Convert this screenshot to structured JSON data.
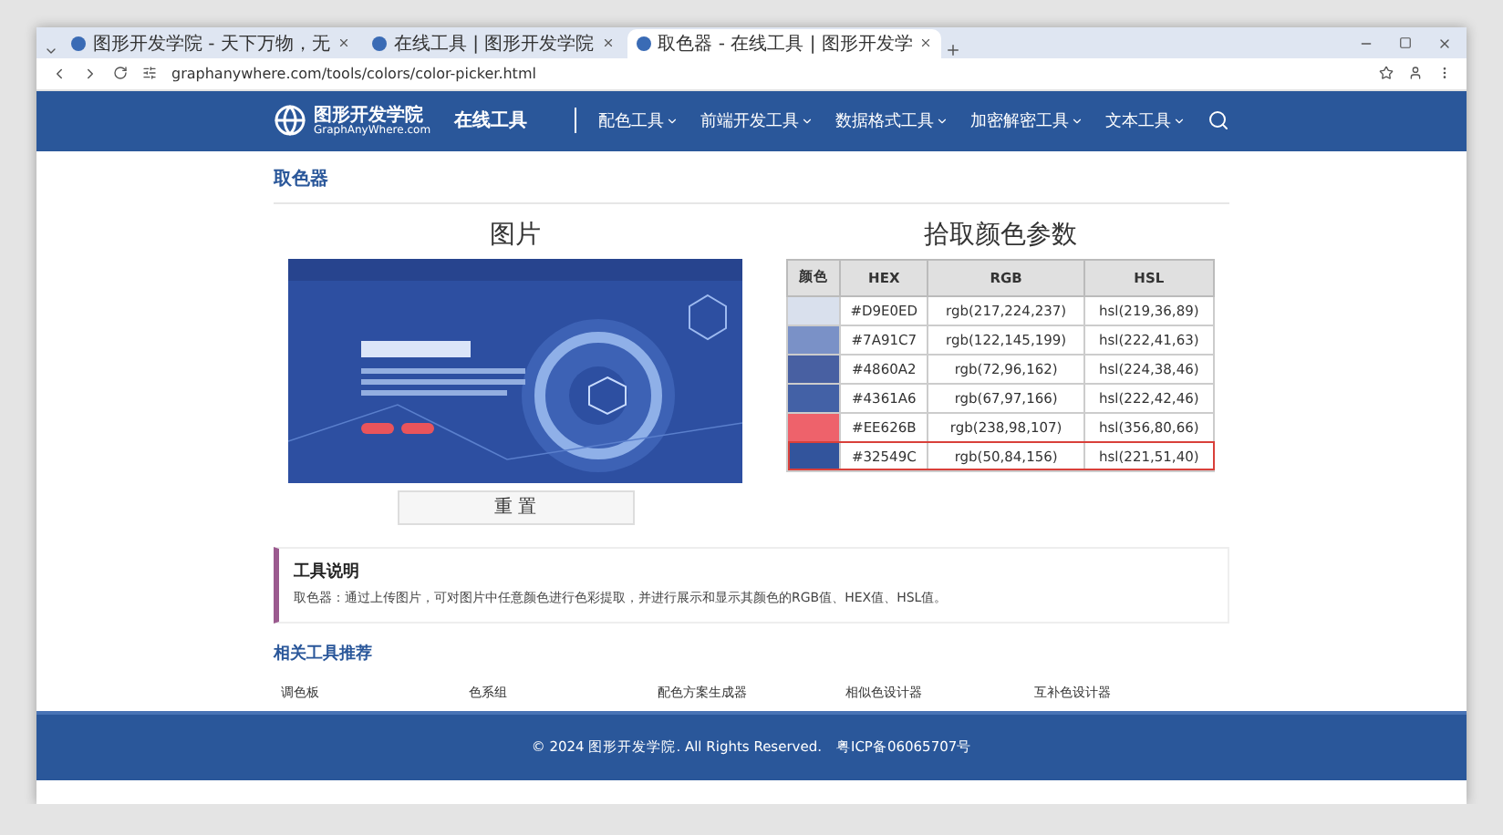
{
  "browser": {
    "tabs": [
      {
        "title": "图形开发学院 - 天下万物，无",
        "selected": false
      },
      {
        "title": "在线工具 | 图形开发学院",
        "selected": false
      },
      {
        "title": "取色器 - 在线工具 | 图形开发学",
        "selected": true
      }
    ],
    "url": "graphanywhere.com/tools/colors/color-picker.html"
  },
  "site": {
    "logo_title": "图形开发学院",
    "logo_subtitle": "GraphAnyWhere.com",
    "nav": [
      {
        "label": "在线工具",
        "selected": true,
        "dropdown": false
      },
      {
        "label": "配色工具",
        "selected": false,
        "dropdown": true
      },
      {
        "label": "前端开发工具",
        "selected": false,
        "dropdown": true
      },
      {
        "label": "数据格式工具",
        "selected": false,
        "dropdown": true
      },
      {
        "label": "加密解密工具",
        "selected": false,
        "dropdown": true
      },
      {
        "label": "文本工具",
        "selected": false,
        "dropdown": true
      }
    ]
  },
  "page_title": "取色器",
  "image_panel": {
    "heading": "图片",
    "reset_button": "重 置"
  },
  "color_panel": {
    "heading": "拾取颜色参数",
    "columns": [
      "颜色",
      "HEX",
      "RGB",
      "HSL"
    ],
    "rows": [
      {
        "color": "#d9e0ed",
        "hex": "#D9E0ED",
        "rgb": "rgb(217,224,237)",
        "hsl": "hsl(219,36,89)",
        "selected": false
      },
      {
        "color": "#7a91c7",
        "hex": "#7A91C7",
        "rgb": "rgb(122,145,199)",
        "hsl": "hsl(222,41,63)",
        "selected": false
      },
      {
        "color": "#4860a2",
        "hex": "#4860A2",
        "rgb": "rgb(72,96,162)",
        "hsl": "hsl(224,38,46)",
        "selected": false
      },
      {
        "color": "#4361a6",
        "hex": "#4361A6",
        "rgb": "rgb(67,97,166)",
        "hsl": "hsl(222,42,46)",
        "selected": false
      },
      {
        "color": "#ee626b",
        "hex": "#EE626B",
        "rgb": "rgb(238,98,107)",
        "hsl": "hsl(356,80,66)",
        "selected": false
      },
      {
        "color": "#32549c",
        "hex": "#32549C",
        "rgb": "rgb(50,84,156)",
        "hsl": "hsl(221,51,40)",
        "selected": true
      }
    ]
  },
  "description": {
    "title": "工具说明",
    "text": "取色器：通过上传图片，可对图片中任意颜色进行色彩提取，并进行展示和显示其颜色的RGB值、HEX值、HSL值。"
  },
  "related": {
    "title": "相关工具推荐",
    "links": [
      "调色板",
      "色系组",
      "配色方案生成器",
      "相似色设计器",
      "互补色设计器"
    ]
  },
  "footer": {
    "copyright": "© 2024 图形开发学院. All Rights Reserved.",
    "icp": "粤ICP备06065707号"
  }
}
